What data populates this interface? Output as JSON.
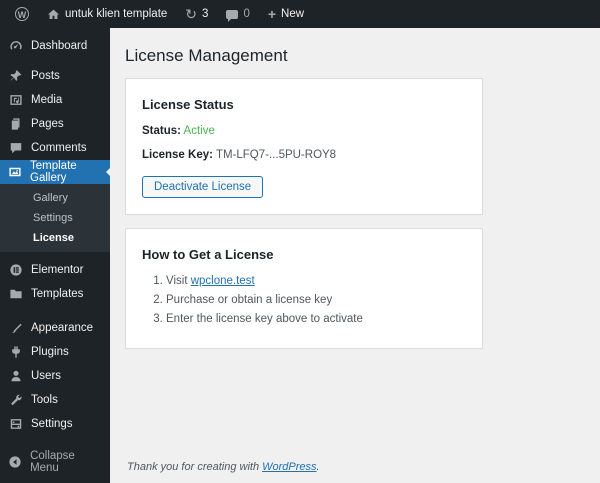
{
  "admin_bar": {
    "wp_logo": "W",
    "site_name": "untuk klien template",
    "updates_count": "3",
    "comments_count": "0",
    "new_label": "New",
    "new_plus": "+"
  },
  "sidebar": {
    "items": [
      {
        "label": "Dashboard",
        "icon": "dashboard-icon"
      },
      {
        "label": "Posts",
        "icon": "pushpin-icon"
      },
      {
        "label": "Media",
        "icon": "media-icon"
      },
      {
        "label": "Pages",
        "icon": "pages-icon"
      },
      {
        "label": "Comments",
        "icon": "comments-icon"
      },
      {
        "label": "Template Gallery",
        "icon": "gallery-icon",
        "active": true
      },
      {
        "label": "Elementor",
        "icon": "elementor-icon"
      },
      {
        "label": "Templates",
        "icon": "folder-icon"
      },
      {
        "label": "Appearance",
        "icon": "paintbrush-icon"
      },
      {
        "label": "Plugins",
        "icon": "plugin-icon"
      },
      {
        "label": "Users",
        "icon": "user-icon"
      },
      {
        "label": "Tools",
        "icon": "wrench-icon"
      },
      {
        "label": "Settings",
        "icon": "settings-icon"
      }
    ],
    "submenu": [
      {
        "label": "Gallery"
      },
      {
        "label": "Settings"
      },
      {
        "label": "License",
        "current": true
      }
    ],
    "collapse_label": "Collapse Menu"
  },
  "main": {
    "page_title": "License Management",
    "license_card": {
      "title": "License Status",
      "status_label": "Status:",
      "status_value": "Active",
      "key_label": "License Key:",
      "key_value": "TM-LFQ7-...5PU-ROY8",
      "deactivate_button": "Deactivate License"
    },
    "howto_card": {
      "title": "How to Get a License",
      "steps": [
        {
          "prefix": "Visit ",
          "link": "wpclone.test"
        },
        {
          "text": "Purchase or obtain a license key"
        },
        {
          "text": "Enter the license key above to activate"
        }
      ]
    },
    "footer": {
      "text": "Thank you for creating with ",
      "link": "WordPress",
      "suffix": "."
    }
  },
  "colors": {
    "admin_bar_bg": "#1d2327",
    "sidebar_bg": "#1d2327",
    "submenu_bg": "#2c3338",
    "active_menu_bg": "#2271b1",
    "content_bg": "#f0f0f1",
    "card_bg": "#ffffff",
    "card_border": "#dcdcde",
    "link_blue": "#2271b1",
    "success_green": "#46b450"
  }
}
